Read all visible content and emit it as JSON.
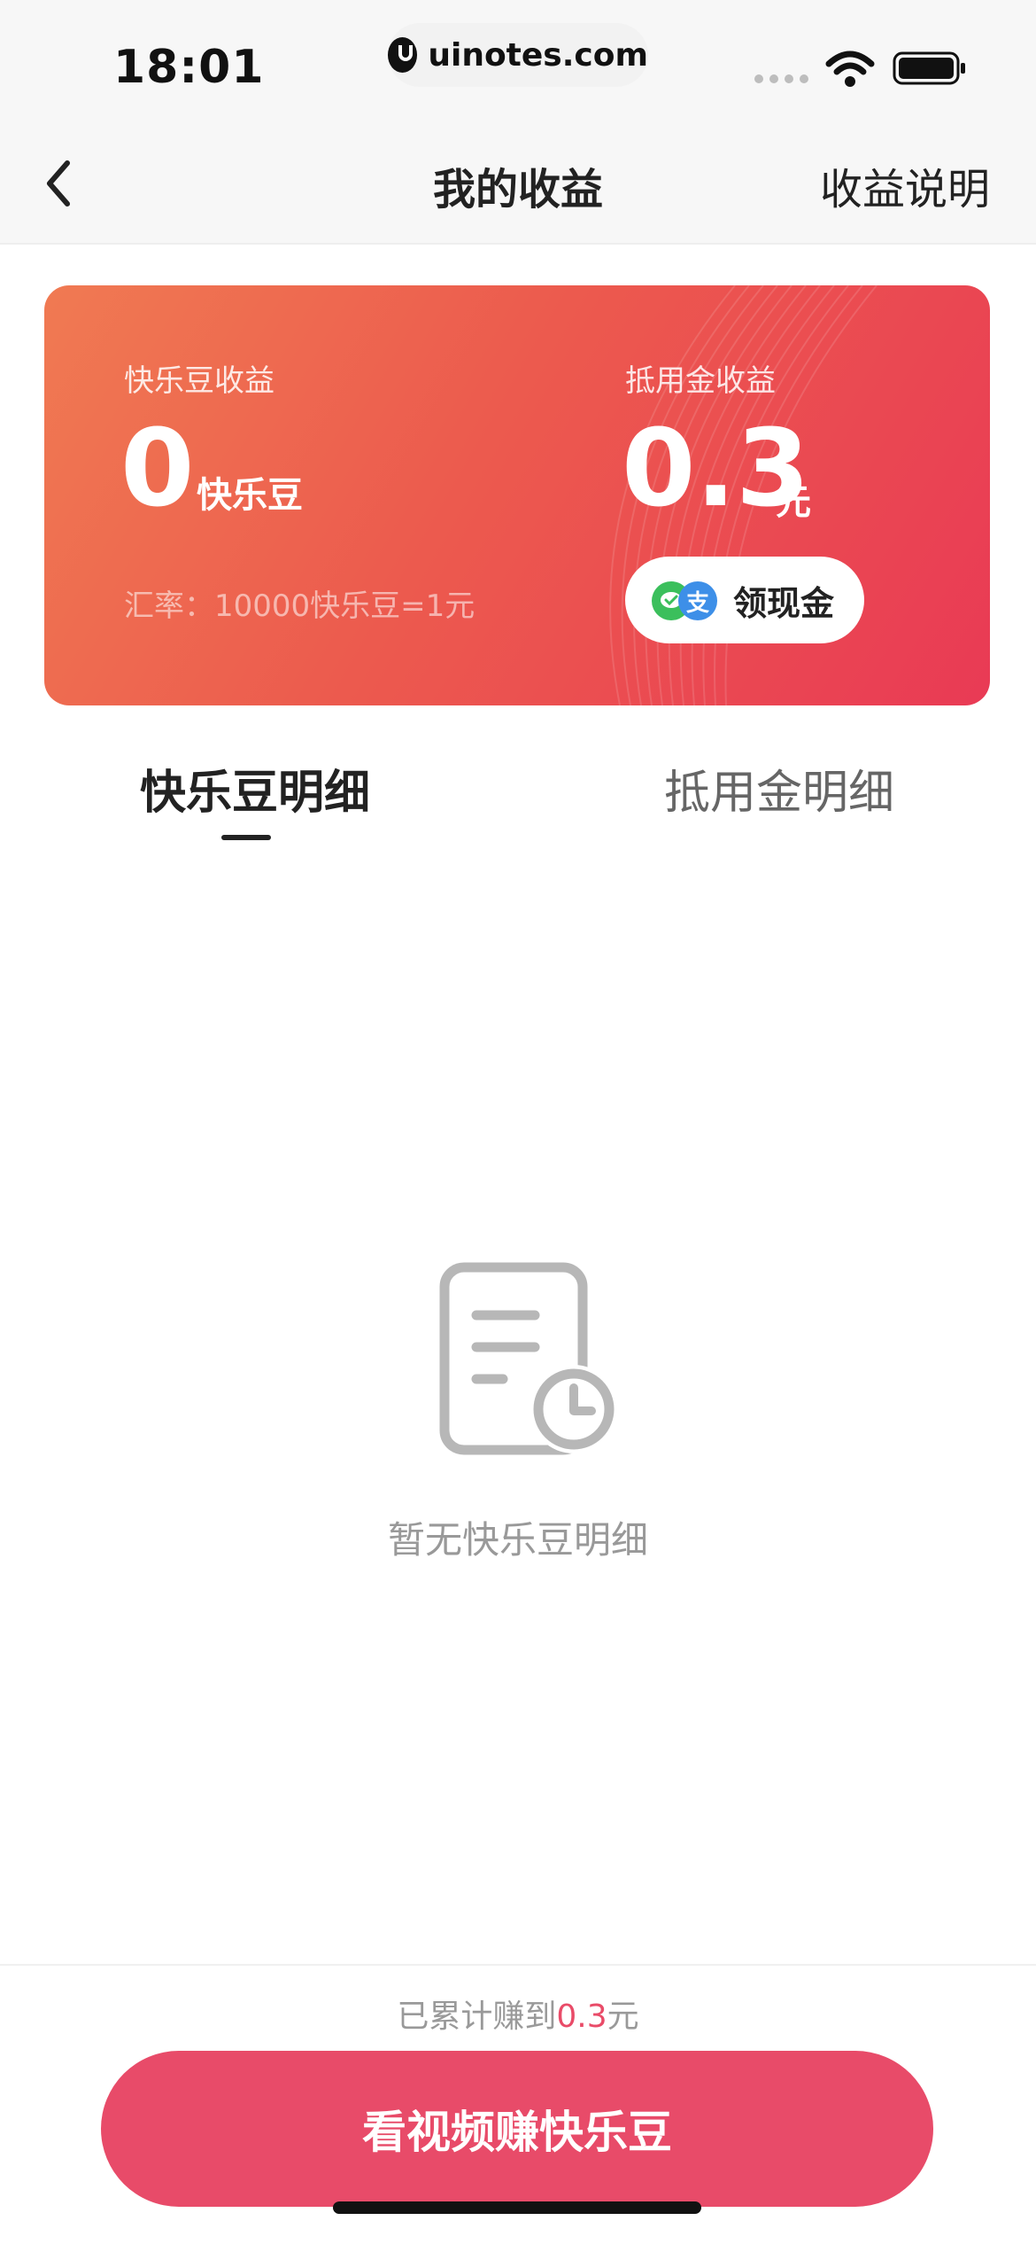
{
  "status_bar": {
    "time": "18:01",
    "url": "uinotes.com"
  },
  "nav": {
    "title": "我的收益",
    "right_link": "收益说明"
  },
  "earnings_card": {
    "beans_label": "快乐豆收益",
    "beans_value": "0",
    "beans_unit": "快乐豆",
    "rate_text": "汇率：10000快乐豆=1元",
    "credit_label": "抵用金收益",
    "credit_value": "0.3",
    "credit_unit": "元",
    "cash_button_label": "领现金",
    "alipay_glyph": "支",
    "gradient_colors": [
      "#f07a52",
      "#e93a55"
    ]
  },
  "tabs": [
    {
      "label": "快乐豆明细",
      "active": true
    },
    {
      "label": "抵用金明细",
      "active": false
    }
  ],
  "empty_state": {
    "icon": "document-clock-icon",
    "text": "暂无快乐豆明细"
  },
  "footer": {
    "earned_prefix": "已累计赚到",
    "earned_amount": "0.3",
    "earned_suffix": "元",
    "cta_label": "看视频赚快乐豆",
    "accent_color": "#e84b69"
  }
}
